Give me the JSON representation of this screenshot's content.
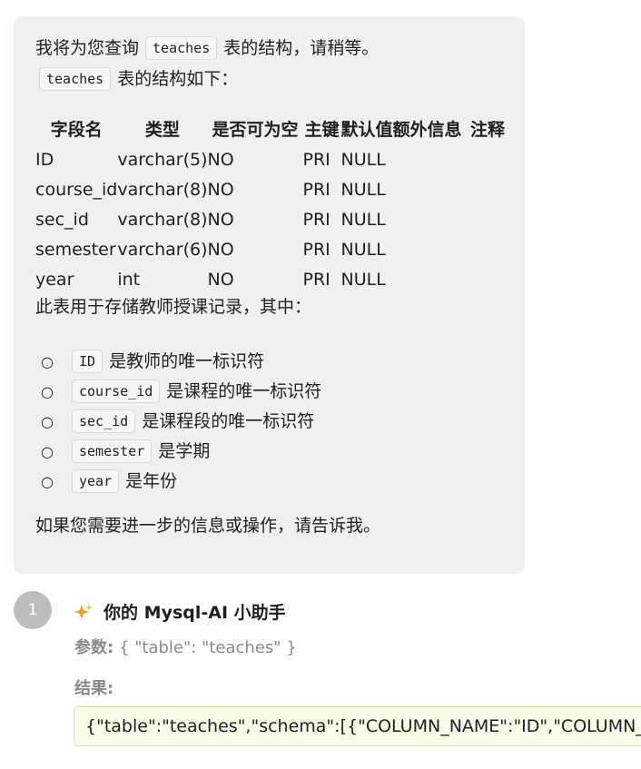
{
  "message": {
    "intro_prefix": "我将为您查询",
    "intro_code": "teaches",
    "intro_suffix": "表的结构，请稍等。",
    "structure_code": "teaches",
    "structure_suffix": "表的结构如下：",
    "table": {
      "headers": [
        "字段名",
        "类型",
        "是否可为空",
        "主键",
        "默认值",
        "额外信息",
        "注释"
      ],
      "rows": [
        [
          "ID",
          "varchar(5)",
          "NO",
          "PRI",
          "NULL",
          "",
          ""
        ],
        [
          "course_id",
          "varchar(8)",
          "NO",
          "PRI",
          "NULL",
          "",
          ""
        ],
        [
          "sec_id",
          "varchar(8)",
          "NO",
          "PRI",
          "NULL",
          "",
          ""
        ],
        [
          "semester",
          "varchar(6)",
          "NO",
          "PRI",
          "NULL",
          "",
          ""
        ],
        [
          "year",
          "int",
          "NO",
          "PRI",
          "NULL",
          "",
          ""
        ]
      ]
    },
    "usage_text": "此表用于存储教师授课记录，其中：",
    "notes": [
      {
        "code": "ID",
        "text": "是教师的唯一标识符"
      },
      {
        "code": "course_id",
        "text": "是课程的唯一标识符"
      },
      {
        "code": "sec_id",
        "text": "是课程段的唯一标识符"
      },
      {
        "code": "semester",
        "text": "是学期"
      },
      {
        "code": "year",
        "text": "是年份"
      }
    ],
    "bullet_symbol": "○",
    "closing_text": "如果您需要进一步的信息或操作，请告诉我。"
  },
  "tool_call": {
    "step_number": "1",
    "sparkle_icon": "sparkle-icon",
    "title": "你的 Mysql-AI 小助手",
    "params_label": "参数:",
    "params_value": "{ \"table\": \"teaches\" }",
    "result_label": "结果:",
    "result_value": "{\"table\":\"teaches\",\"schema\":[{\"COLUMN_NAME\":\"ID\",\"COLUMN_TYPE\":\"varchar(5)\",\"IS_NULLABLE\":\"NO\",\"COLUMN_KEY\":\"PRI\",\"COLUMN_DEFAULT\":null,\"EXTRA\":\"\",\"COLUMN_COMMENT\":\"\"}]}"
  },
  "colors": {
    "bubble_background": "#f0f0f0",
    "step_circle": "#bdbdbd",
    "result_background": "#f7fde9",
    "result_border": "#cfe6a8",
    "muted_text": "#8a8a8a",
    "sparkle": "#f0a020"
  }
}
